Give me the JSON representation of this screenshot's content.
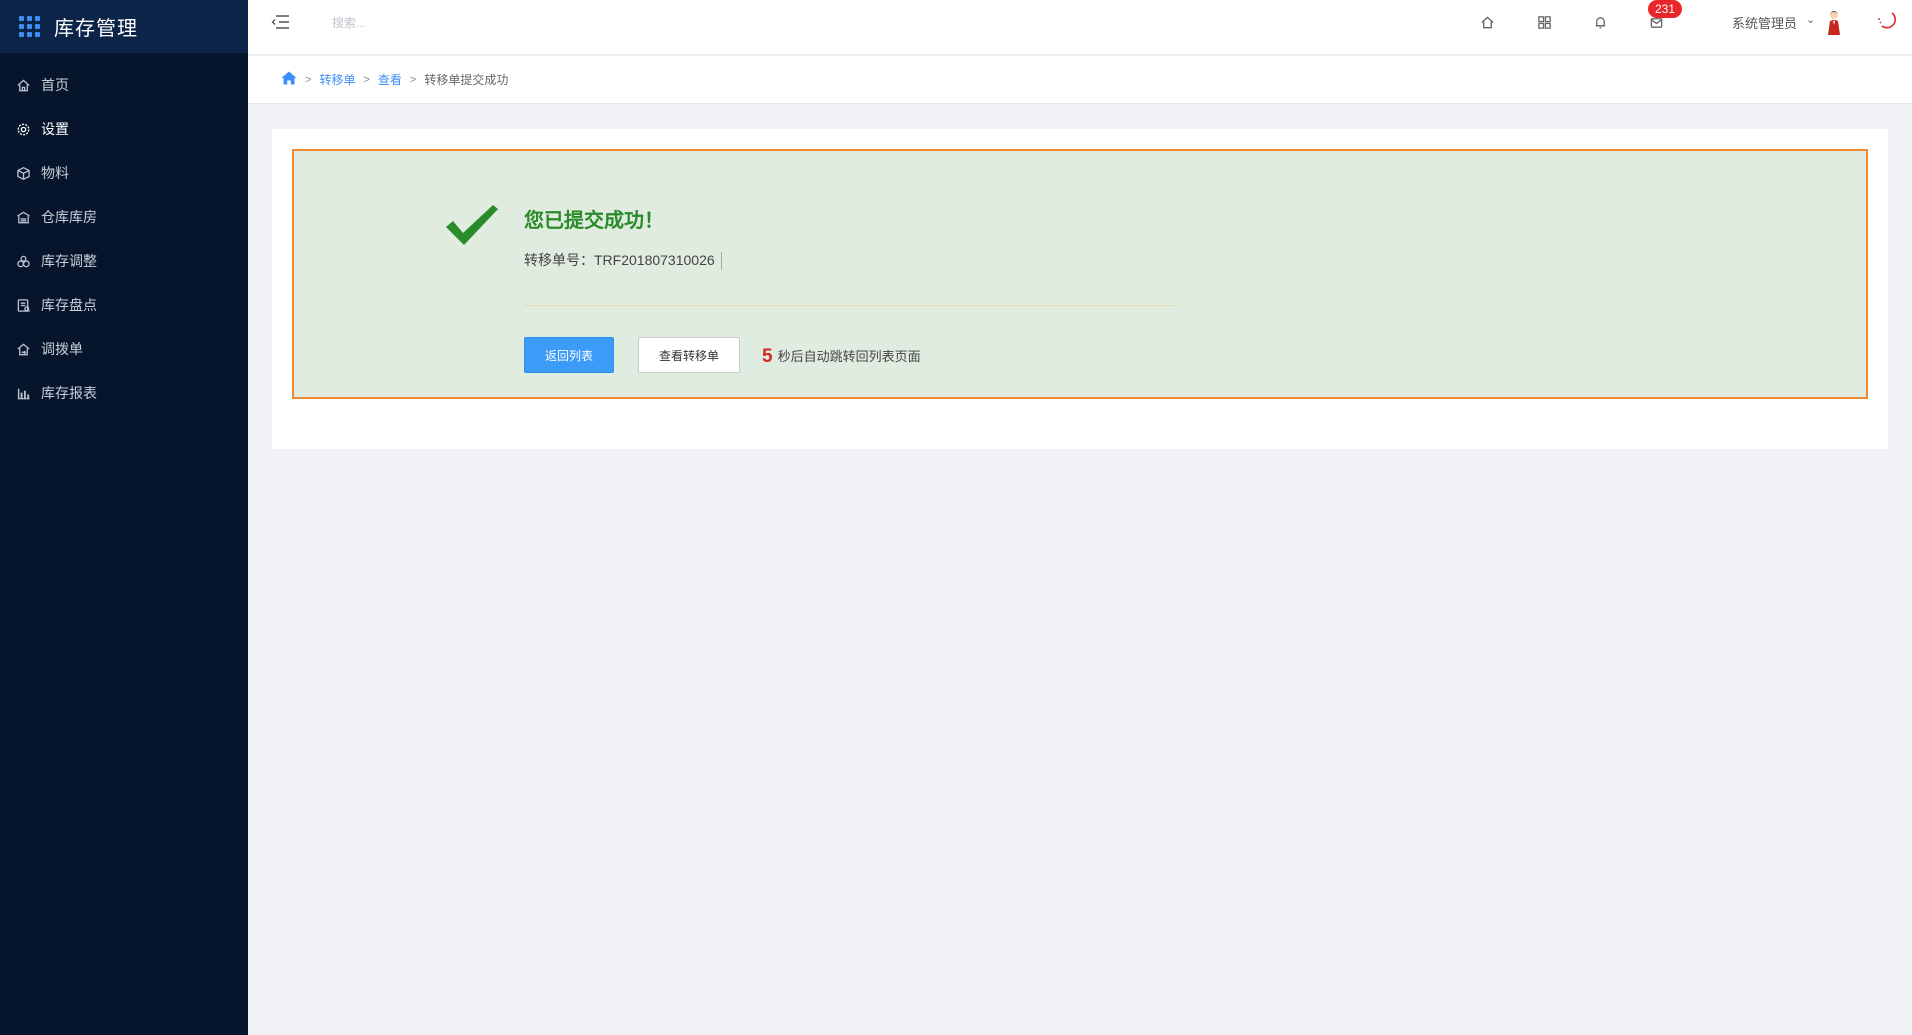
{
  "app": {
    "title": "库存管理"
  },
  "sidebar": {
    "items": [
      {
        "label": "首页",
        "icon": "home-icon"
      },
      {
        "label": "设置",
        "icon": "gear-icon",
        "active": true
      },
      {
        "label": "物料",
        "icon": "box-icon"
      },
      {
        "label": "仓库库房",
        "icon": "warehouse-icon"
      },
      {
        "label": "库存调整",
        "icon": "adjust-icon"
      },
      {
        "label": "库存盘点",
        "icon": "inventory-check-icon"
      },
      {
        "label": "调拨单",
        "icon": "transfer-icon"
      },
      {
        "label": "库存报表",
        "icon": "bar-chart-icon"
      }
    ]
  },
  "header": {
    "search": {
      "placeholder": "搜索..."
    },
    "notification_badge": "231",
    "user_name": "系统管理员"
  },
  "breadcrumb": {
    "items": [
      "转移单",
      "查看"
    ],
    "current": "转移单提交成功"
  },
  "result": {
    "title": "您已提交成功！",
    "order_label": "转移单号：",
    "order_number": "TRF201807310026",
    "back_button": "返回列表",
    "view_button": "查看转移单",
    "countdown_seconds": "5",
    "countdown_text": "秒后自动跳转回列表页面"
  },
  "colors": {
    "sidebar_bg": "#06152b",
    "logo_bar_bg": "#0b2447",
    "accent": "#3d9bf8",
    "success_green": "#2a8b2a",
    "box_border": "#f08a2c",
    "box_bg": "#e0ecdf",
    "badge_red": "#e8262a"
  }
}
